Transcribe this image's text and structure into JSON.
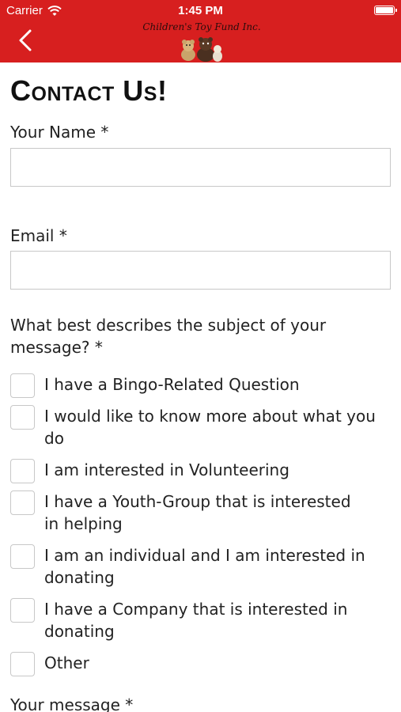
{
  "status": {
    "carrier": "Carrier",
    "time": "1:45 PM"
  },
  "header": {
    "brand": "Children's Toy Fund Inc."
  },
  "page": {
    "title": "Contact Us!"
  },
  "form": {
    "name_label": "Your Name *",
    "name_value": "",
    "email_label": "Email *",
    "email_value": "",
    "subject_label": "What best describes the subject of your message? *",
    "options": [
      "I have a Bingo-Related Question",
      "I would like to know more about what you do",
      "I am interested in Volunteering",
      "I have a Youth-Group that is interested in helping",
      "I am an individual and I am interested in donating",
      "I have a Company that is interested in donating",
      "Other"
    ],
    "message_label": "Your message *"
  },
  "colors": {
    "header": "#d71f1f",
    "border": "#c8c8c8"
  },
  "icons": [
    "wifi-icon",
    "battery-icon",
    "back-chevron-icon",
    "teddy-bear-logo-icon"
  ]
}
